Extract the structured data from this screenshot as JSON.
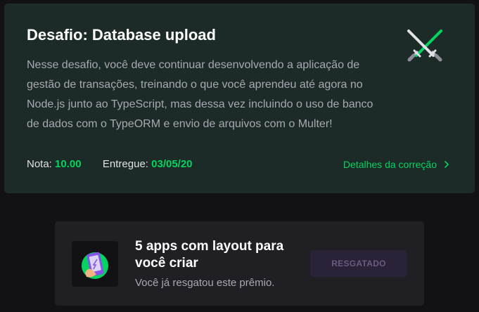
{
  "challenge": {
    "title": "Desafio: Database upload",
    "description": "Nesse desafio, você deve continuar desenvolvendo a aplicação de gestão de transações, treinando o que você aprendeu até agora no Node.js junto ao TypeScript, mas dessa vez incluindo o uso de banco de dados com o TypeORM e envio de arquivos com o Multer!",
    "icon": "crossed-swords-icon",
    "grade_label": "Nota:",
    "grade_value": "10.00",
    "delivered_label": "Entregue:",
    "delivered_value": "03/05/20",
    "details_link": "Detalhes da correção"
  },
  "reward": {
    "title": "5 apps com layout para você criar",
    "subtitle": "Você já resgatou este prêmio.",
    "button_label": "RESGATADO",
    "icon": "phone-app-icon"
  },
  "colors": {
    "background": "#121214",
    "challenge_card": "#1c2b27",
    "reward_card": "#202024",
    "accent_green": "#04d361",
    "muted_text": "#a8a8b3"
  }
}
